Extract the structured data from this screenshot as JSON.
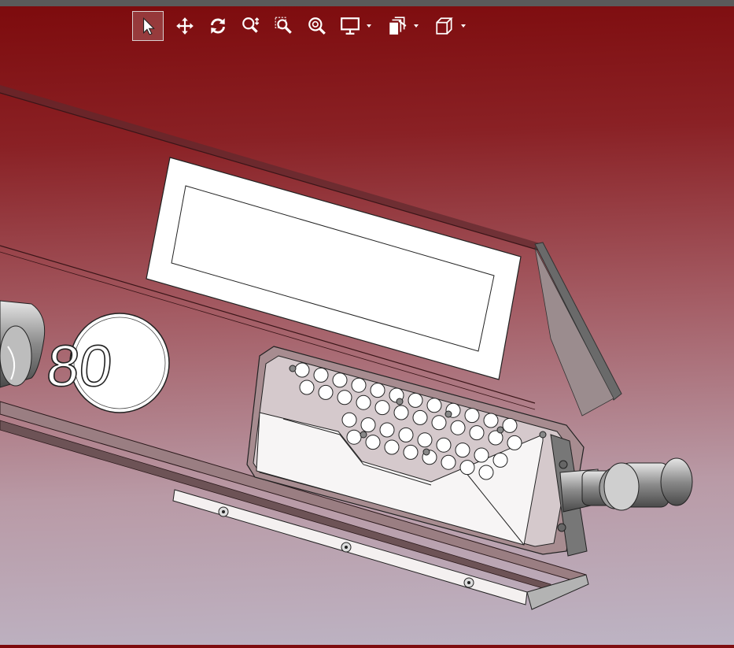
{
  "toolbar": {
    "tools": [
      {
        "id": "select",
        "icon": "select-arrow-icon",
        "active": true
      },
      {
        "id": "pan",
        "icon": "pan-move-icon",
        "active": false
      },
      {
        "id": "rotate",
        "icon": "rotate-icon",
        "active": false
      },
      {
        "id": "zoom",
        "icon": "zoom-icon",
        "active": false
      },
      {
        "id": "zoom-window",
        "icon": "zoom-window-icon",
        "active": false
      },
      {
        "id": "zoom-fit",
        "icon": "zoom-fit-icon",
        "active": false
      },
      {
        "id": "display",
        "icon": "display-monitor-icon",
        "dropdown": true
      },
      {
        "id": "section",
        "icon": "section-view-icon",
        "dropdown": true
      },
      {
        "id": "view-orientation",
        "icon": "view-cube-icon",
        "dropdown": true
      }
    ]
  },
  "model": {
    "speed_badge_text": "80",
    "colors": {
      "background_top": "#7d0a0c",
      "background_bottom": "#bdb4c4",
      "panel": "#e9e1e4",
      "label": "#ffffff",
      "metal": "#9a9a9a"
    }
  }
}
